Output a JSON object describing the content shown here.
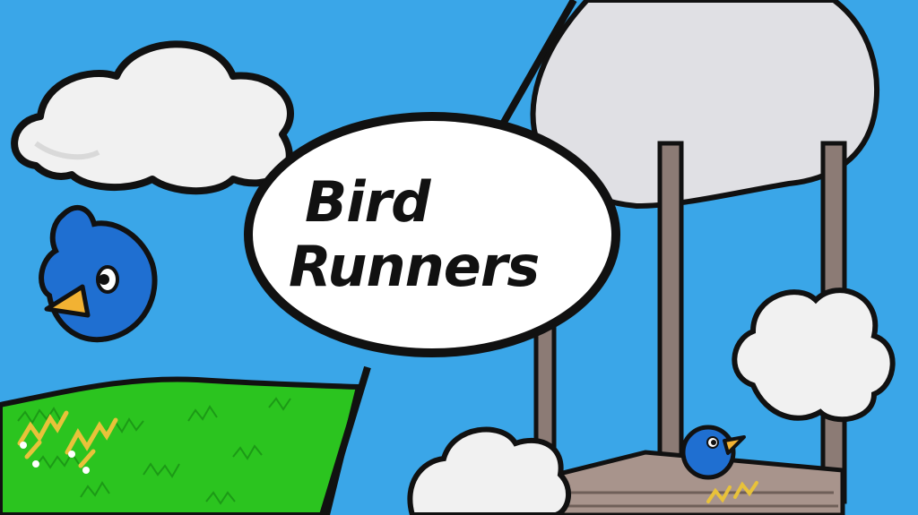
{
  "title": {
    "line1": "Bird",
    "line2": "Runners"
  },
  "colors": {
    "sky": "#3aa6e8",
    "grass": "#29c21f",
    "bird": "#1f6fd1",
    "beak": "#f2b233",
    "cloud": "#f1f1f1",
    "wood": "#8c7b75"
  },
  "icons": [
    "cloud-icon",
    "blue-bird-icon",
    "wooden-tower-icon",
    "grass-field-icon",
    "wheat-icon"
  ]
}
